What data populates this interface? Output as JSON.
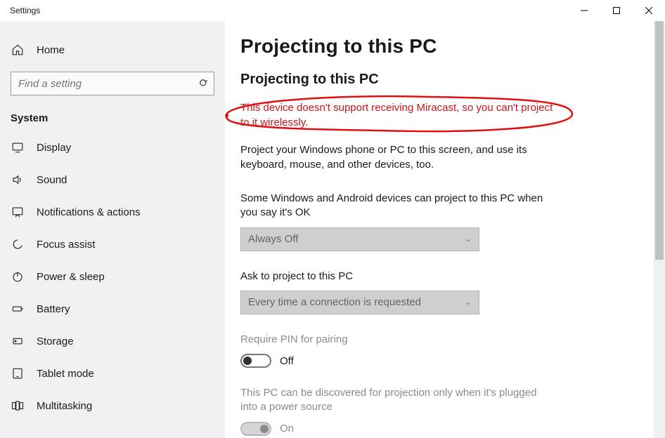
{
  "window": {
    "title": "Settings",
    "controls": {
      "min": "minimize",
      "max": "maximize",
      "close": "close"
    }
  },
  "sidebar": {
    "home": "Home",
    "search_placeholder": "Find a setting",
    "category": "System",
    "items": [
      {
        "icon": "display-icon",
        "label": "Display"
      },
      {
        "icon": "sound-icon",
        "label": "Sound"
      },
      {
        "icon": "notifications-icon",
        "label": "Notifications & actions"
      },
      {
        "icon": "focus-assist-icon",
        "label": "Focus assist"
      },
      {
        "icon": "power-icon",
        "label": "Power & sleep"
      },
      {
        "icon": "battery-icon",
        "label": "Battery"
      },
      {
        "icon": "storage-icon",
        "label": "Storage"
      },
      {
        "icon": "tablet-mode-icon",
        "label": "Tablet mode"
      },
      {
        "icon": "multitasking-icon",
        "label": "Multitasking"
      }
    ]
  },
  "main": {
    "page_title": "Projecting to this PC",
    "section_title": "Projecting to this PC",
    "warning": "This device doesn't support receiving Miracast, so you can't project to it wirelessly.",
    "description": "Project your Windows phone or PC to this screen, and use its keyboard, mouse, and other devices, too.",
    "field1_label": "Some Windows and Android devices can project to this PC when you say it's OK",
    "field1_value": "Always Off",
    "field2_label": "Ask to project to this PC",
    "field2_value": "Every time a connection is requested",
    "field3_label": "Require PIN for pairing",
    "field3_value": "Off",
    "field4_label": "This PC can be discovered for projection only when it's plugged into a power source",
    "field4_value": "On"
  }
}
